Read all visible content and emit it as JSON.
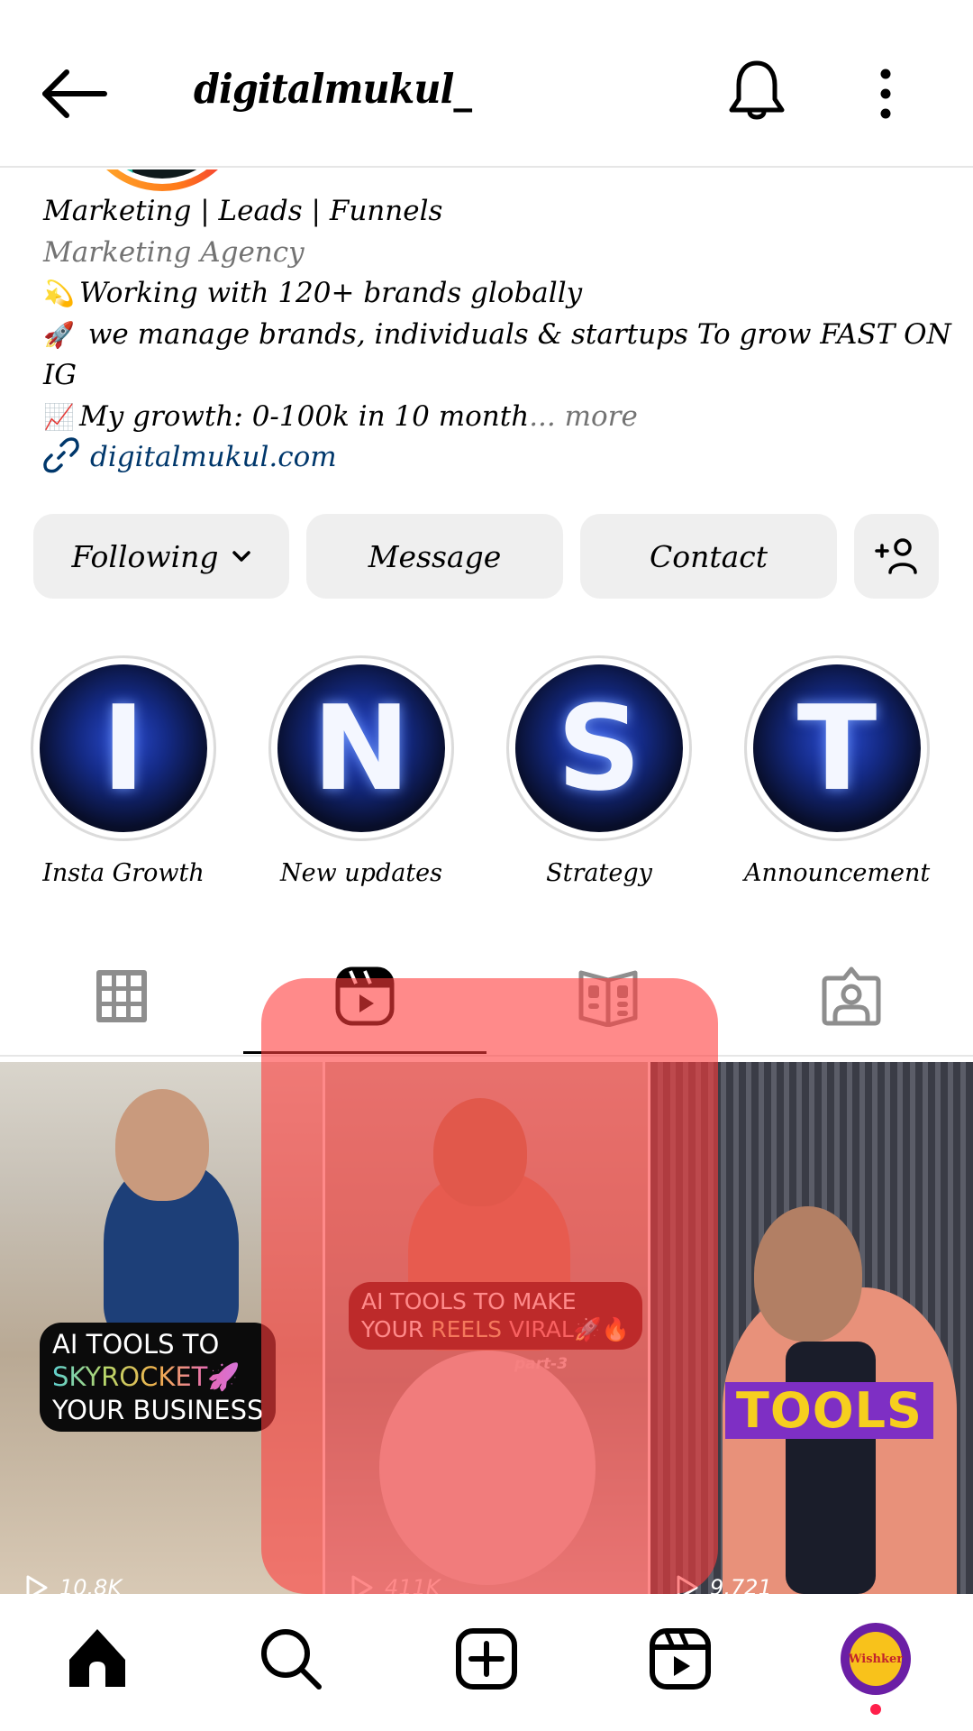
{
  "header": {
    "username": "digitalmukul_",
    "back_icon": "arrow-left-icon",
    "bell_icon": "bell-icon",
    "more_icon": "more-vertical-icon"
  },
  "bio": {
    "name_line": "Marketing | Leads | Funnels",
    "category": "Marketing Agency",
    "lines": [
      {
        "emoji": "💫",
        "text": "Working with 120+ brands globally"
      },
      {
        "emoji": "🚀",
        "text": " we manage brands, individuals & startups To grow FAST ON"
      },
      {
        "emoji": "",
        "text": "IG"
      },
      {
        "emoji": "📈",
        "text": "My growth: 0-100k  in 10 month"
      }
    ],
    "more_label": "... more",
    "link": "digitalmukul.com"
  },
  "actions": {
    "following_label": "Following",
    "message_label": "Message",
    "contact_label": "Contact",
    "add_user_icon": "add-person-icon"
  },
  "highlights": [
    {
      "letter": "I",
      "label": "Insta Growth"
    },
    {
      "letter": "N",
      "label": "New updates"
    },
    {
      "letter": "S",
      "label": "Strategy"
    },
    {
      "letter": "T",
      "label": "Announcement"
    }
  ],
  "tabs": [
    {
      "name": "posts",
      "icon": "grid-icon",
      "active": false
    },
    {
      "name": "reels",
      "icon": "reels-icon",
      "active": true
    },
    {
      "name": "guides",
      "icon": "guide-book-icon",
      "active": false
    },
    {
      "name": "tagged",
      "icon": "tagged-person-icon",
      "active": false
    }
  ],
  "reels": [
    {
      "caption_lines": [
        "AI TOOLS TO",
        "SKYROCKET🚀",
        "YOUR BUSINESS"
      ],
      "views": "10.8K"
    },
    {
      "caption_lines": [
        "AI TOOLS TO MAKE",
        "YOUR ",
        "REELS",
        " VIRAL",
        "🚀🔥"
      ],
      "subtitle": "part-3",
      "views": "411K"
    },
    {
      "caption_lines": [
        "TOOLS"
      ],
      "views": "9,721"
    }
  ],
  "bottom_nav": {
    "items": [
      "home",
      "search",
      "create",
      "reels",
      "profile"
    ],
    "profile_avatar_text": "Wishker",
    "profile_has_notification": true
  },
  "colors": {
    "link": "#00376b",
    "secondary_text": "#737373",
    "button_bg": "#efefef",
    "overlay": "#ff3c3c",
    "notification_dot": "#ff1f4a"
  }
}
